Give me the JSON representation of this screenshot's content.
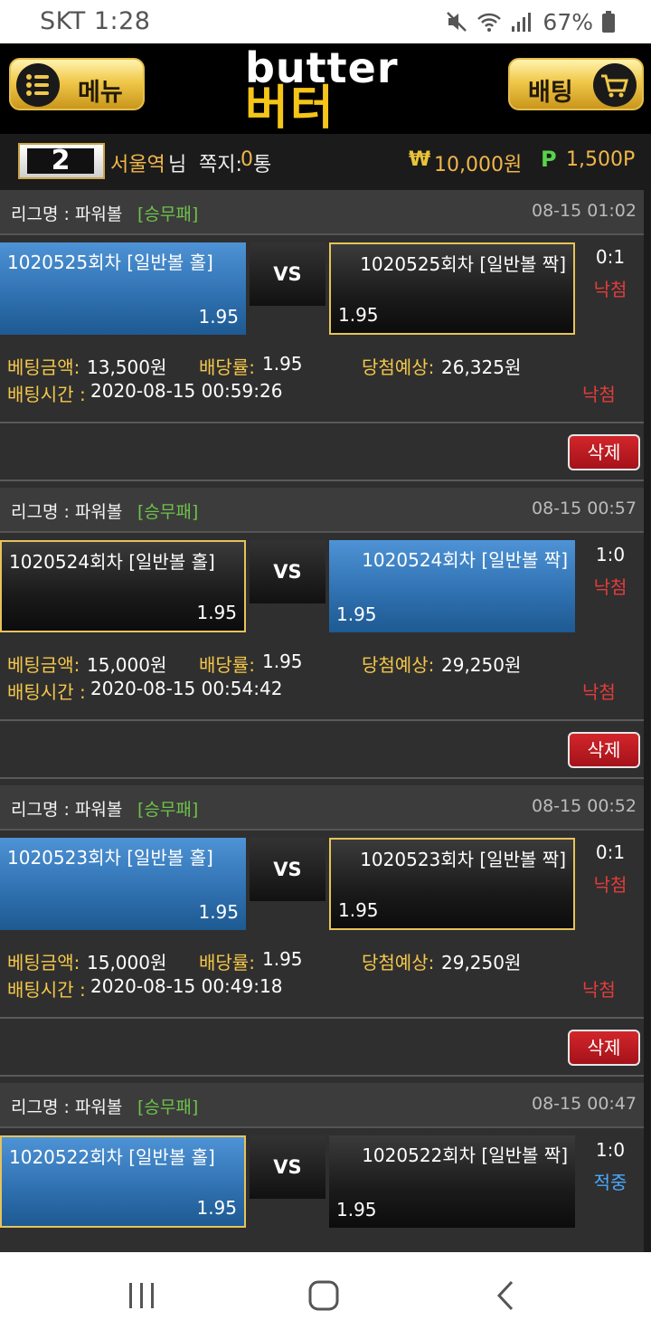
{
  "status_bar": {
    "carrier_time": "SKT 1:28",
    "battery": "67%"
  },
  "header": {
    "menu_label": "메뉴",
    "bet_label": "배팅",
    "logo_en": "butter",
    "logo_ko": "버터"
  },
  "user": {
    "level": "2",
    "name": "서울역",
    "honorific": "님",
    "message_label": "쪽지:",
    "message_count": "0",
    "message_unit": "통",
    "won_symbol": "₩",
    "money": "10,000원",
    "point_symbol": "P",
    "point": "1,500P"
  },
  "bets": [
    {
      "league_label": "리그명 : 파워볼",
      "league_type": "[승무패]",
      "time": "08-15 01:02",
      "home": {
        "name": "1020525회차 [일반볼 홀]",
        "odds": "1.95"
      },
      "vs": "VS",
      "away": {
        "name": "1020525회차 [일반볼 짝]",
        "odds": "1.95"
      },
      "score": "0:1",
      "result": "낙첨",
      "amount_label": "베팅금액:",
      "amount": "13,500원",
      "odds_label": "배당률:",
      "odds": "1.95",
      "expected_label": "당첨예상:",
      "expected": "26,325원",
      "time_label": "배팅시간 :",
      "bet_time": "2020-08-15 00:59:26",
      "final_result": "낙첨",
      "delete_label": "삭제"
    },
    {
      "league_label": "리그명 : 파워볼",
      "league_type": "[승무패]",
      "time": "08-15 00:57",
      "home": {
        "name": "1020524회차 [일반볼 홀]",
        "odds": "1.95"
      },
      "vs": "VS",
      "away": {
        "name": "1020524회차 [일반볼 짝]",
        "odds": "1.95"
      },
      "score": "1:0",
      "result": "낙첨",
      "amount_label": "베팅금액:",
      "amount": "15,000원",
      "odds_label": "배당률:",
      "odds": "1.95",
      "expected_label": "당첨예상:",
      "expected": "29,250원",
      "time_label": "배팅시간 :",
      "bet_time": "2020-08-15 00:54:42",
      "final_result": "낙첨",
      "delete_label": "삭제"
    },
    {
      "league_label": "리그명 : 파워볼",
      "league_type": "[승무패]",
      "time": "08-15 00:52",
      "home": {
        "name": "1020523회차 [일반볼 홀]",
        "odds": "1.95"
      },
      "vs": "VS",
      "away": {
        "name": "1020523회차 [일반볼 짝]",
        "odds": "1.95"
      },
      "score": "0:1",
      "result": "낙첨",
      "amount_label": "베팅금액:",
      "amount": "15,000원",
      "odds_label": "배당률:",
      "odds": "1.95",
      "expected_label": "당첨예상:",
      "expected": "29,250원",
      "time_label": "배팅시간 :",
      "bet_time": "2020-08-15 00:49:18",
      "final_result": "낙첨",
      "delete_label": "삭제"
    },
    {
      "league_label": "리그명 : 파워볼",
      "league_type": "[승무패]",
      "time": "08-15 00:47",
      "home": {
        "name": "1020522회차 [일반볼 홀]",
        "odds": "1.95"
      },
      "vs": "VS",
      "away": {
        "name": "1020522회차 [일반볼 짝]",
        "odds": "1.95"
      },
      "score": "1:0",
      "result": "적중"
    }
  ],
  "colors": {
    "gold": "#f0b64a",
    "lose": "#e23c3c",
    "win": "#4aa9ff",
    "league_type": "#6ec24c"
  }
}
